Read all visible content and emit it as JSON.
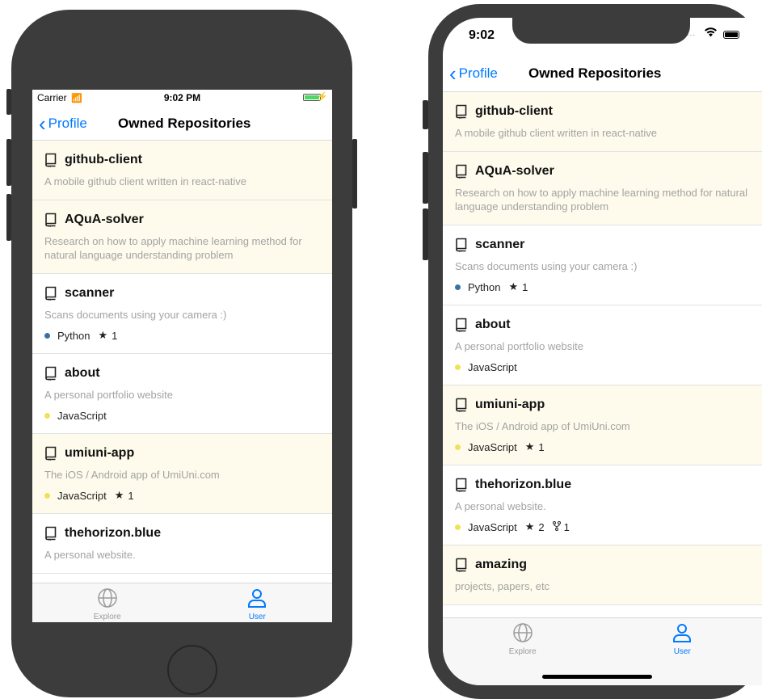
{
  "colors": {
    "accent": "#007aff",
    "highlight_row": "#fefbec",
    "python": "#3572a5",
    "javascript": "#f1e05a"
  },
  "nav": {
    "back_label": "Profile",
    "title": "Owned Repositories"
  },
  "tabs": [
    {
      "label": "Explore",
      "icon": "globe-icon",
      "active": false
    },
    {
      "label": "User",
      "icon": "user-icon",
      "active": true
    }
  ],
  "phone1": {
    "status": {
      "carrier": "Carrier",
      "time": "9:02 PM"
    },
    "repos": [
      {
        "name": "github-client",
        "description": "A mobile github client written in react-native",
        "language": null,
        "stars": null,
        "forks": null,
        "highlighted": true
      },
      {
        "name": "AQuA-solver",
        "description": "Research on how to apply machine learning method for natural language understanding problem",
        "language": null,
        "stars": null,
        "forks": null,
        "highlighted": true
      },
      {
        "name": "scanner",
        "description": "Scans documents using your camera :)",
        "language": "Python",
        "stars": "1",
        "forks": null,
        "highlighted": false
      },
      {
        "name": "about",
        "description": "A personal portfolio website",
        "language": "JavaScript",
        "stars": null,
        "forks": null,
        "highlighted": false
      },
      {
        "name": "umiuni-app",
        "description": "The iOS / Android app of UmiUni.com",
        "language": "JavaScript",
        "stars": "1",
        "forks": null,
        "highlighted": true
      },
      {
        "name": "thehorizon.blue",
        "description": "A personal website.",
        "language": null,
        "stars": null,
        "forks": null,
        "highlighted": false
      }
    ]
  },
  "phone2": {
    "status": {
      "time": "9:02"
    },
    "repos": [
      {
        "name": "github-client",
        "description": "A mobile github client written in react-native",
        "language": null,
        "stars": null,
        "forks": null,
        "highlighted": true
      },
      {
        "name": "AQuA-solver",
        "description": "Research on how to apply machine learning method for natural language understanding problem",
        "language": null,
        "stars": null,
        "forks": null,
        "highlighted": true
      },
      {
        "name": "scanner",
        "description": "Scans documents using your camera :)",
        "language": "Python",
        "stars": "1",
        "forks": null,
        "highlighted": false
      },
      {
        "name": "about",
        "description": "A personal portfolio website",
        "language": "JavaScript",
        "stars": null,
        "forks": null,
        "highlighted": false
      },
      {
        "name": "umiuni-app",
        "description": "The iOS / Android app of UmiUni.com",
        "language": "JavaScript",
        "stars": "1",
        "forks": null,
        "highlighted": true
      },
      {
        "name": "thehorizon.blue",
        "description": "A personal website.",
        "language": "JavaScript",
        "stars": "2",
        "forks": "1",
        "highlighted": false
      },
      {
        "name": "amazing",
        "description": "projects, papers, etc",
        "language": null,
        "stars": null,
        "forks": null,
        "highlighted": true
      }
    ]
  }
}
